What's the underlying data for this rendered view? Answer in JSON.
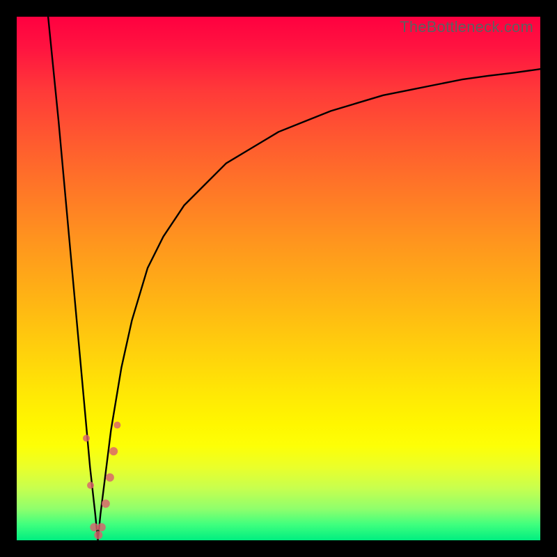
{
  "watermark": "TheBottleneck.com",
  "colors": {
    "frame": "#000000",
    "curve": "#000000",
    "points": "#d9626c"
  },
  "chart_data": {
    "type": "line",
    "title": "",
    "xlabel": "",
    "ylabel": "",
    "xlim": [
      0,
      100
    ],
    "ylim": [
      0,
      100
    ],
    "grid": false,
    "legend": false,
    "description": "Bottleneck percentage curve. X-axis is relative component performance, Y-axis is bottleneck percentage (0 = no bottleneck, green; 100 = severe bottleneck, red). The curve drops steeply from ~100% at x≈6 to 0% at x≈15.5, then rises asymptotically toward ~90% as x→100.",
    "series": [
      {
        "name": "bottleneck-curve",
        "x": [
          6,
          8,
          10,
          12,
          13,
          14,
          15,
          15.5,
          16,
          17,
          18,
          20,
          22,
          25,
          28,
          32,
          36,
          40,
          45,
          50,
          55,
          60,
          65,
          70,
          75,
          80,
          85,
          90,
          95,
          100
        ],
        "y": [
          100,
          80,
          58,
          36,
          25,
          14,
          5,
          0,
          5,
          13,
          21,
          33,
          42,
          52,
          58,
          64,
          68,
          72,
          75,
          78,
          80,
          82,
          83.5,
          85,
          86,
          87,
          88,
          88.7,
          89.3,
          90
        ]
      }
    ],
    "points": [
      {
        "x": 13.3,
        "y": 19.5,
        "r": 5
      },
      {
        "x": 14.1,
        "y": 10.5,
        "r": 5
      },
      {
        "x": 14.8,
        "y": 2.5,
        "r": 6
      },
      {
        "x": 15.6,
        "y": 1.0,
        "r": 6
      },
      {
        "x": 16.2,
        "y": 2.5,
        "r": 6
      },
      {
        "x": 17.0,
        "y": 7.0,
        "r": 6
      },
      {
        "x": 17.8,
        "y": 12.0,
        "r": 6
      },
      {
        "x": 18.5,
        "y": 17.0,
        "r": 6
      },
      {
        "x": 19.2,
        "y": 22.0,
        "r": 5
      }
    ]
  }
}
